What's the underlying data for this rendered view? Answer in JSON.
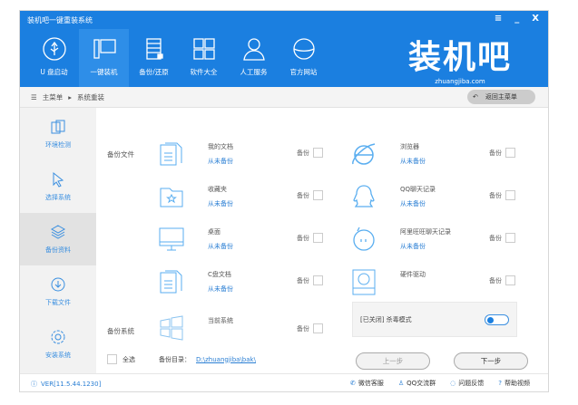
{
  "title": "装机吧一键重装系统",
  "window_controls": {
    "menu": "≡",
    "minimize": "_",
    "close": "X"
  },
  "nav": [
    {
      "label": "U 盘启动",
      "icon": "usb-icon"
    },
    {
      "label": "一键装机",
      "icon": "computer-icon"
    },
    {
      "label": "备份/还原",
      "icon": "backup-icon"
    },
    {
      "label": "软件大全",
      "icon": "grid-icon"
    },
    {
      "label": "人工服务",
      "icon": "person-icon"
    },
    {
      "label": "官方网站",
      "icon": "globe-icon"
    }
  ],
  "logo": {
    "text": "装机吧",
    "url": "zhuangjiba.com"
  },
  "breadcrumb": {
    "root": "主菜单",
    "current": "系统重装",
    "back": "返回主菜单"
  },
  "sidebar": [
    {
      "label": "环境检测"
    },
    {
      "label": "选择系统"
    },
    {
      "label": "备份资料"
    },
    {
      "label": "下载文件"
    },
    {
      "label": "安装系统"
    }
  ],
  "content": {
    "backup_files_label": "备份文件",
    "backup_system_label": "备份系统",
    "backup_label": "备份",
    "items": [
      {
        "name": "我的文档",
        "status": "从未备份"
      },
      {
        "name": "浏览器",
        "status": "从未备份"
      },
      {
        "name": "收藏夹",
        "status": "从未备份"
      },
      {
        "name": "QQ聊天记录",
        "status": "从未备份"
      },
      {
        "name": "桌面",
        "status": "从未备份"
      },
      {
        "name": "阿里旺旺聊天记录",
        "status": "从未备份"
      },
      {
        "name": "C盘文档",
        "status": "从未备份"
      },
      {
        "name": "硬件驱动",
        "status": ""
      }
    ],
    "system_item": {
      "name": "当前系统"
    },
    "antivirus": "[已关闭] 杀毒模式",
    "select_all": "全选",
    "dir_label": "备份目录：",
    "dir_path": "D:\\zhuangjiba\\bak\\",
    "prev": "上一步",
    "next": "下一步"
  },
  "footer": {
    "version": "VER[11.5.44.1230]",
    "links": [
      "微信客服",
      "QQ交流群",
      "问题反馈",
      "帮助视频"
    ]
  }
}
